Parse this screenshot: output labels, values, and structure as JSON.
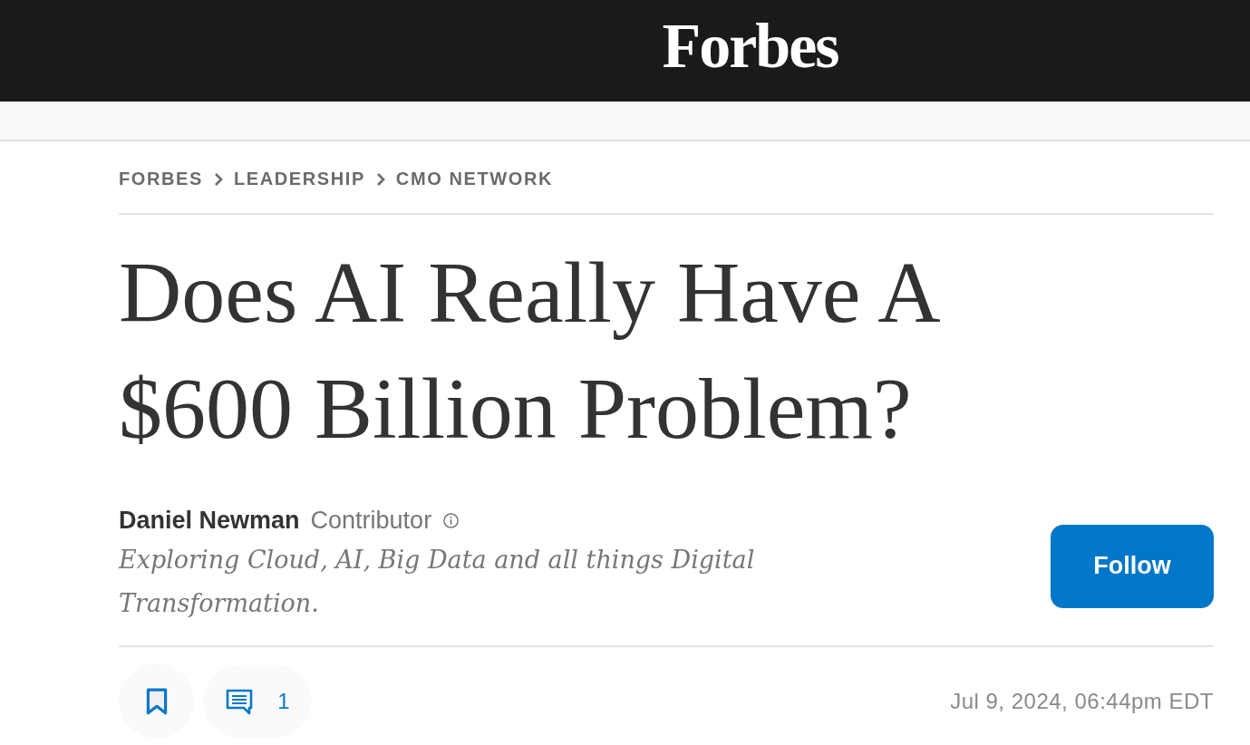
{
  "header": {
    "logo": "Forbes"
  },
  "breadcrumbs": [
    "FORBES",
    "LEADERSHIP",
    "CMO NETWORK"
  ],
  "headline": "Does AI Really Have A $600 Billion Problem?",
  "author": {
    "name": "Daniel Newman",
    "role": "Contributor",
    "bio": "Exploring Cloud, AI, Big Data and all things Digital Transformation."
  },
  "follow_button": "Follow",
  "actions": {
    "comment_count": "1"
  },
  "timestamp": "Jul 9, 2024, 06:44pm EDT"
}
